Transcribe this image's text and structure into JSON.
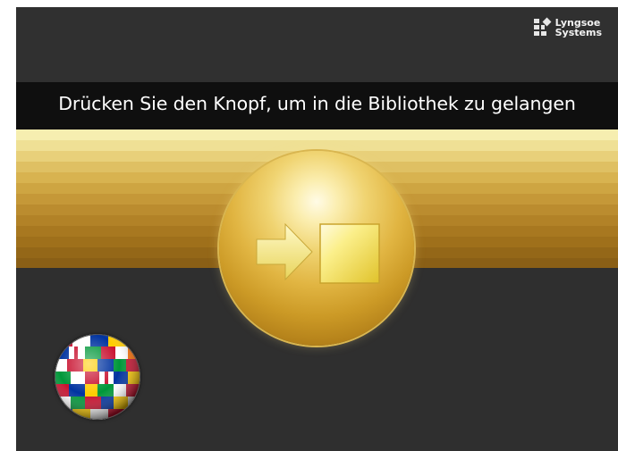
{
  "logo": {
    "line1": "Lyngsoe",
    "line2": "Systems",
    "icon": "lyngsoe-logo-mark"
  },
  "title": "Drücken Sie den Knopf, um in die Bibliothek zu gelangen",
  "enter_button": {
    "icon": "enter-arrow-icon"
  },
  "language_globe": {
    "icon": "flags-globe-icon"
  },
  "colors": {
    "background": "#2f2f2f",
    "title_bar": "#0f0f0f",
    "gold": "#d8b350",
    "arrow_yellow": "#f3e98a"
  }
}
